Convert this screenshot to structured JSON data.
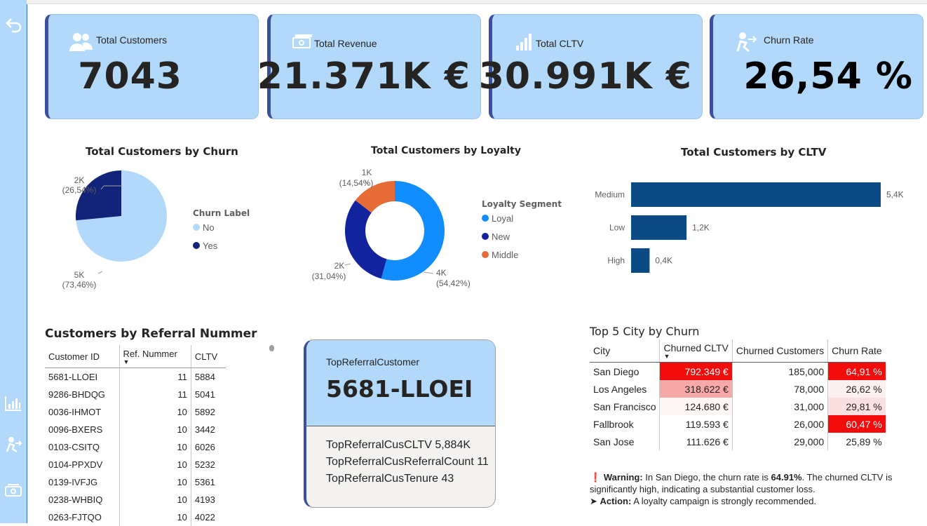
{
  "kpis": [
    {
      "label": "Total Customers",
      "value": "7043",
      "icon": "people-icon"
    },
    {
      "label": "Total Revenue",
      "value": "21.371K €",
      "icon": "money-icon"
    },
    {
      "label": "Total CLTV",
      "value": "30.991K €",
      "icon": "bar-chart-icon"
    },
    {
      "label": "Churn Rate",
      "value": "26,54 %",
      "icon": "person-leaving-icon"
    }
  ],
  "sidebar": {
    "icons": [
      "back-arrow-icon",
      "bar-chart-icon",
      "person-leaving-icon",
      "money-icon"
    ]
  },
  "churn_pie": {
    "title": "Total Customers by Churn",
    "legend_title": "Churn Label",
    "legend": [
      {
        "label": "No",
        "color": "#b3d9fa"
      },
      {
        "label": "Yes",
        "color": "#12237a"
      }
    ],
    "label_yes_value": "2K",
    "label_yes_pct": "(26,54%)",
    "label_no_value": "5K",
    "label_no_pct": "(73,46%)"
  },
  "loyalty_donut": {
    "title": "Total Customers by Loyalty",
    "legend_title": "Loyalty Segment",
    "legend": [
      {
        "label": "Loyal",
        "color": "#118dff"
      },
      {
        "label": "New",
        "color": "#12239e"
      },
      {
        "label": "Middle",
        "color": "#e66c37"
      }
    ],
    "label_loyal_value": "4K",
    "label_loyal_pct": "(54,42%)",
    "label_new_value": "2K",
    "label_new_pct": "(31,04%)",
    "label_middle_value": "1K",
    "label_middle_pct": "(14,54%)"
  },
  "cltv_chart": {
    "title": "Total Customers by CLTV"
  },
  "chart_data": [
    {
      "type": "pie",
      "title": "Total Customers by Churn",
      "categories": [
        "No",
        "Yes"
      ],
      "values": [
        5174,
        1869
      ],
      "percent_labels": [
        "73,46%",
        "26,54%"
      ],
      "colors": [
        "#b3d9fa",
        "#12237a"
      ],
      "legend": "right"
    },
    {
      "type": "pie",
      "title": "Total Customers by Loyalty",
      "donut": true,
      "categories": [
        "Loyal",
        "New",
        "Middle"
      ],
      "values": [
        54.42,
        31.04,
        14.54
      ],
      "colors": [
        "#118dff",
        "#12239e",
        "#e66c37"
      ],
      "legend": "right"
    },
    {
      "type": "bar",
      "orientation": "horizontal",
      "title": "Total Customers by CLTV",
      "categories": [
        "Medium",
        "Low",
        "High"
      ],
      "values": [
        5.4,
        1.2,
        0.4
      ],
      "value_labels": [
        "5,4K",
        "1,2K",
        "0,4K"
      ],
      "color": "#0b4a85",
      "xlim": [
        0,
        5.4
      ]
    }
  ],
  "referral": {
    "title": "Customers by Referral Nummer",
    "headers": [
      "Customer ID",
      "Ref. Nummer",
      "CLTV"
    ],
    "rows": [
      [
        "5681-LLOEI",
        "11",
        "5884"
      ],
      [
        "9286-BHDQG",
        "11",
        "5041"
      ],
      [
        "0036-IHMOT",
        "10",
        "5892"
      ],
      [
        "0096-BXERS",
        "10",
        "3442"
      ],
      [
        "0103-CSITQ",
        "10",
        "6026"
      ],
      [
        "0104-PPXDV",
        "10",
        "5232"
      ],
      [
        "0139-IVFJG",
        "10",
        "5361"
      ],
      [
        "0238-WHBIQ",
        "10",
        "4193"
      ],
      [
        "0263-FJTQO",
        "10",
        "4022"
      ]
    ]
  },
  "top_card": {
    "label": "TopReferralCustomer",
    "value": "5681-LLOEI",
    "lines": [
      "TopReferralCusCLTV 5,884K",
      "TopReferralCusReferralCount 11",
      "TopReferralCusTenure 43"
    ]
  },
  "city": {
    "title": "Top 5 City by Churn",
    "headers": [
      "City",
      "Churned CLTV",
      "Churned Customers",
      "Churn Rate"
    ],
    "rows": [
      {
        "city": "San Diego",
        "cltv": "792.349 €",
        "customers": "185,000",
        "rate": "64,91 %",
        "cltv_bg": "#f20c0c",
        "rate_bg": "#f20c0c"
      },
      {
        "city": "Los Angeles",
        "cltv": "318.622 €",
        "customers": "78,000",
        "rate": "26,62 %",
        "cltv_bg": "#f7a8a8",
        "rate_bg": "#fdf0f0"
      },
      {
        "city": "San Francisco",
        "cltv": "124.680 €",
        "customers": "31,000",
        "rate": "29,81 %",
        "cltv_bg": "#fef5f5",
        "rate_bg": "#fbe0e0"
      },
      {
        "city": "Fallbrook",
        "cltv": "119.593 €",
        "customers": "26,000",
        "rate": "60,47 %",
        "cltv_bg": "#ffffff",
        "rate_bg": "#f20c0c"
      },
      {
        "city": "San Jose",
        "cltv": "111.626 €",
        "customers": "29,000",
        "rate": "25,89 %",
        "cltv_bg": "#ffffff",
        "rate_bg": "#ffffff"
      }
    ]
  },
  "warning": {
    "icon": "❗",
    "label": "Warning:",
    "text1": "In San Diego, the churn rate is",
    "rate": "64.91%",
    "text2": ". The churned CLTV is significantly high, indicating a substantial customer loss.",
    "arrow": "➤",
    "action_label": "Action:",
    "action_text": "A loyalty campaign is strongly recommended."
  }
}
